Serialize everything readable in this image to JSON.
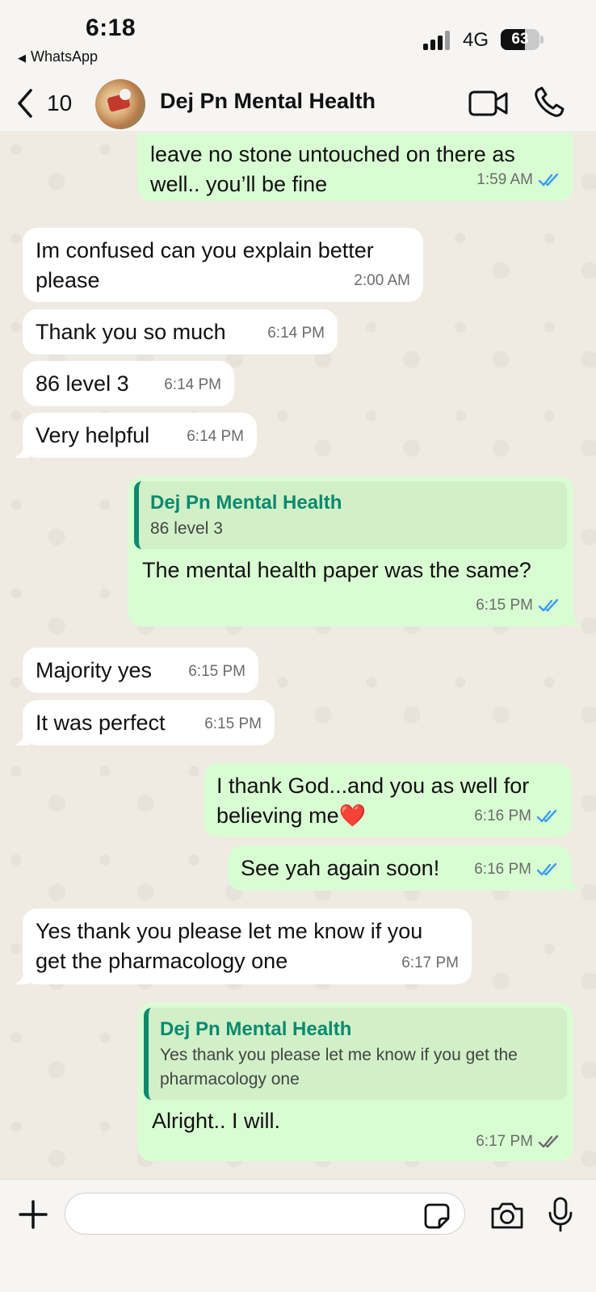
{
  "status_bar": {
    "time": "6:18",
    "back_app": "WhatsApp",
    "network": "4G",
    "battery": "63",
    "battery_level": 0.63
  },
  "header": {
    "back_count": "10",
    "title": "Dej Pn Mental Health",
    "icons": [
      "back-chevron-icon",
      "video-call-icon",
      "voice-call-icon"
    ]
  },
  "messages": [
    {
      "dir": "out",
      "text": "leave no stone untouched on there as well.. you’ll be fine",
      "time": "1:59 AM",
      "read": true
    },
    {
      "dir": "in",
      "text": "Im confused can you explain better please",
      "time": "2:00 AM"
    },
    {
      "dir": "in",
      "text": "Thank you so much",
      "time": "6:14 PM"
    },
    {
      "dir": "in",
      "text": "86 level 3",
      "time": "6:14 PM"
    },
    {
      "dir": "in",
      "text": "Very helpful",
      "time": "6:14 PM"
    },
    {
      "dir": "out",
      "reply_name": "Dej Pn Mental Health",
      "reply_text": "86 level 3",
      "text": "The mental health paper was the same?",
      "time": "6:15 PM",
      "read": true
    },
    {
      "dir": "in",
      "text": "Majority yes",
      "time": "6:15 PM"
    },
    {
      "dir": "in",
      "text": "It was perfect",
      "time": "6:15 PM"
    },
    {
      "dir": "out",
      "text": "I thank God...and you as well for believing me❤️",
      "time": "6:16 PM",
      "read": true
    },
    {
      "dir": "out",
      "text": "See yah again soon!",
      "time": "6:16 PM",
      "read": true
    },
    {
      "dir": "in",
      "text": "Yes thank you please let me know if you get the pharmacology one",
      "time": "6:17 PM"
    },
    {
      "dir": "out",
      "reply_name": "Dej Pn Mental Health",
      "reply_text": "Yes thank you please let me know if you get the pharmacology one",
      "text": "Alright.. I will.",
      "time": "6:17 PM",
      "read": false
    }
  ],
  "composer": {
    "placeholder": "",
    "icons": [
      "plus-icon",
      "sticker-icon",
      "camera-icon",
      "microphone-icon"
    ]
  },
  "colors": {
    "incoming": "#ffffff",
    "outgoing": "#d9fdd3",
    "read_tick": "#3b9cf5",
    "reply_accent": "#0b8a6f"
  }
}
